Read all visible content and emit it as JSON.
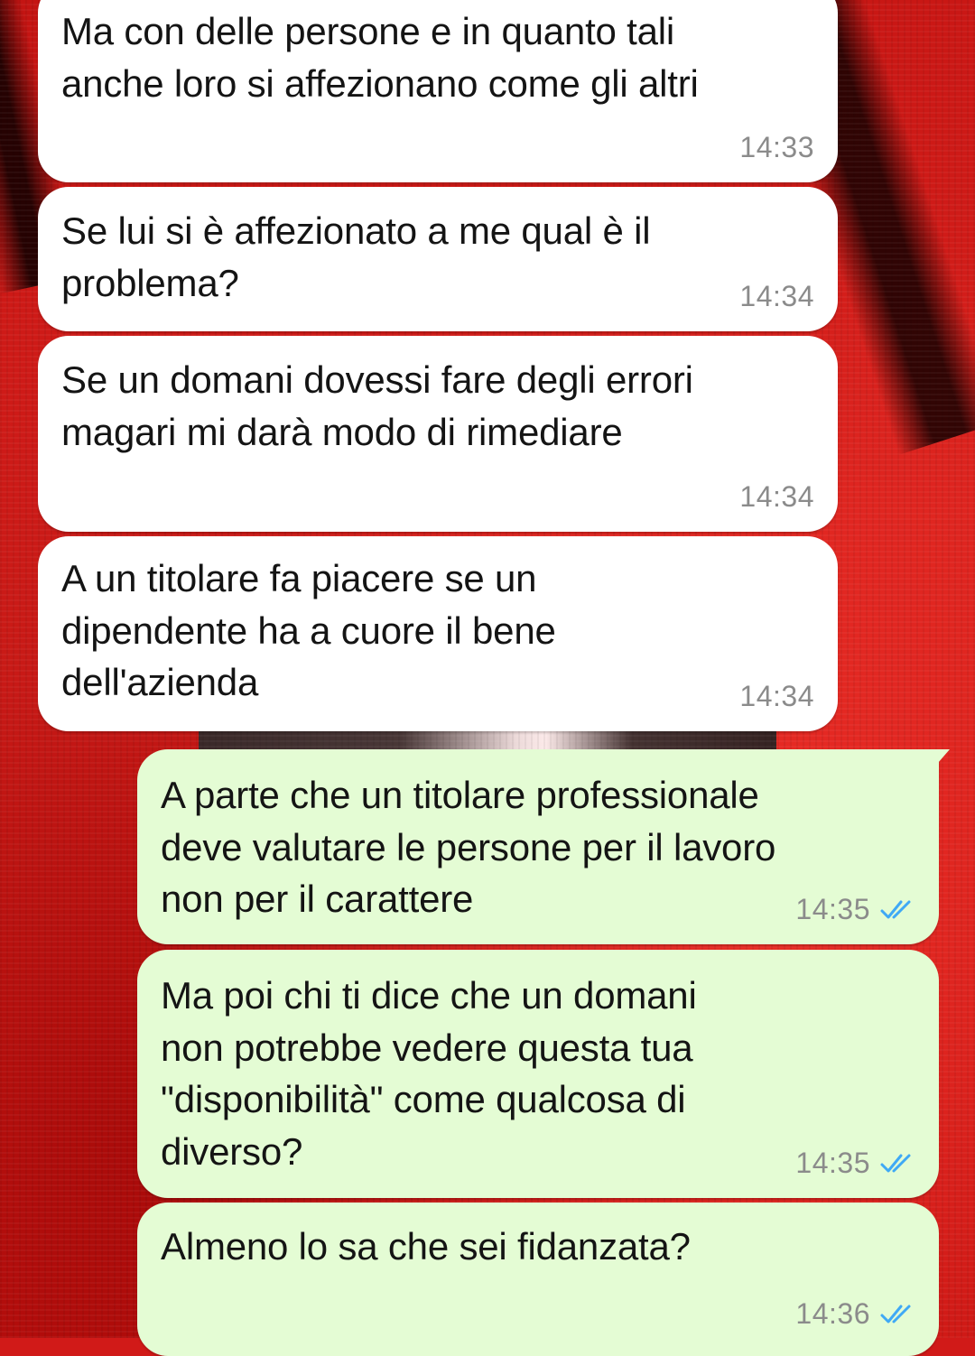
{
  "colors": {
    "incoming_bubble": "#ffffff",
    "outgoing_bubble": "#e4fcd4",
    "timestamp": "#8b8b8b",
    "read_receipt": "#3fa9f5",
    "wallpaper": "#d11a18"
  },
  "messages": [
    {
      "direction": "incoming",
      "text": "Ma con delle persone e in quanto tali\nanche loro si affezionano come gli altri",
      "time": "14:33"
    },
    {
      "direction": "incoming",
      "text": "Se lui si è affezionato a me qual è il\nproblema?",
      "time": "14:34"
    },
    {
      "direction": "incoming",
      "text": "Se un domani dovessi fare degli errori\nmagari mi darà modo di rimediare",
      "time": "14:34"
    },
    {
      "direction": "incoming",
      "text": "A un titolare fa piacere se un\ndipendente ha a cuore il bene\ndell'azienda",
      "time": "14:34"
    },
    {
      "direction": "outgoing",
      "text": "A parte che un titolare professionale\ndeve valutare le persone per il lavoro\nnon per il carattere",
      "time": "14:35",
      "status_icon": "double-check-read-icon"
    },
    {
      "direction": "outgoing",
      "text": "Ma poi chi ti dice che un domani\nnon potrebbe vedere questa tua\n\"disponibilità\" come qualcosa di\ndiverso?",
      "time": "14:35",
      "status_icon": "double-check-read-icon"
    },
    {
      "direction": "outgoing",
      "text": "Almeno lo sa che sei fidanzata?",
      "time": "14:36",
      "status_icon": "double-check-read-icon"
    }
  ]
}
